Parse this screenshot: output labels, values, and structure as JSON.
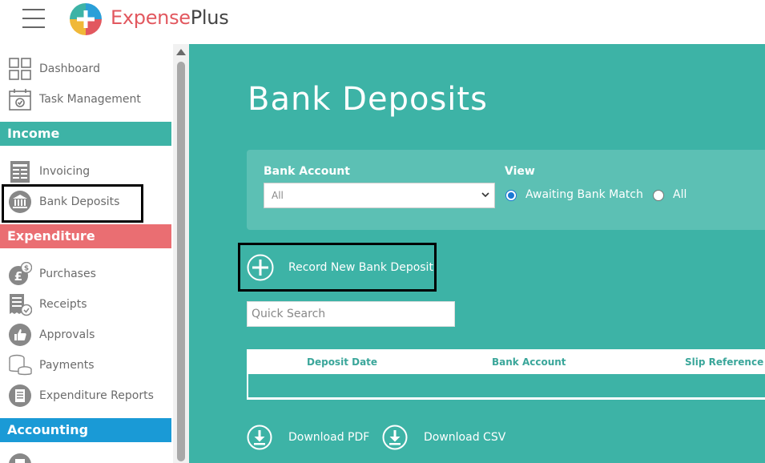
{
  "brand": {
    "part1": "Expense",
    "part2": "Plus"
  },
  "sidebar": {
    "dashboard": "Dashboard",
    "task_management": "Task Management",
    "income_header": "Income",
    "invoicing": "Invoicing",
    "bank_deposits": "Bank Deposits",
    "expenditure_header": "Expenditure",
    "purchases": "Purchases",
    "receipts": "Receipts",
    "approvals": "Approvals",
    "payments": "Payments",
    "expenditure_reports": "Expenditure Reports",
    "accounting_header": "Accounting"
  },
  "main": {
    "title": "Bank Deposits",
    "filters": {
      "bank_account_label": "Bank Account",
      "bank_account_value": "All",
      "view_label": "View",
      "view_options": [
        "Awaiting Bank Match",
        "All"
      ],
      "view_selected": "Awaiting Bank Match"
    },
    "record_button": "Record New Bank Deposit",
    "search_placeholder": "Quick Search",
    "table": {
      "columns": [
        "Deposit Date",
        "Bank Account",
        "Slip Reference"
      ],
      "rows": []
    },
    "download_pdf": "Download PDF",
    "download_csv": "Download CSV"
  },
  "colors": {
    "teal": "#3db3a6",
    "income": "#3db3a6",
    "expenditure": "#ea6e72",
    "accounting": "#1a9ad6",
    "brand_red": "#e2585f"
  }
}
